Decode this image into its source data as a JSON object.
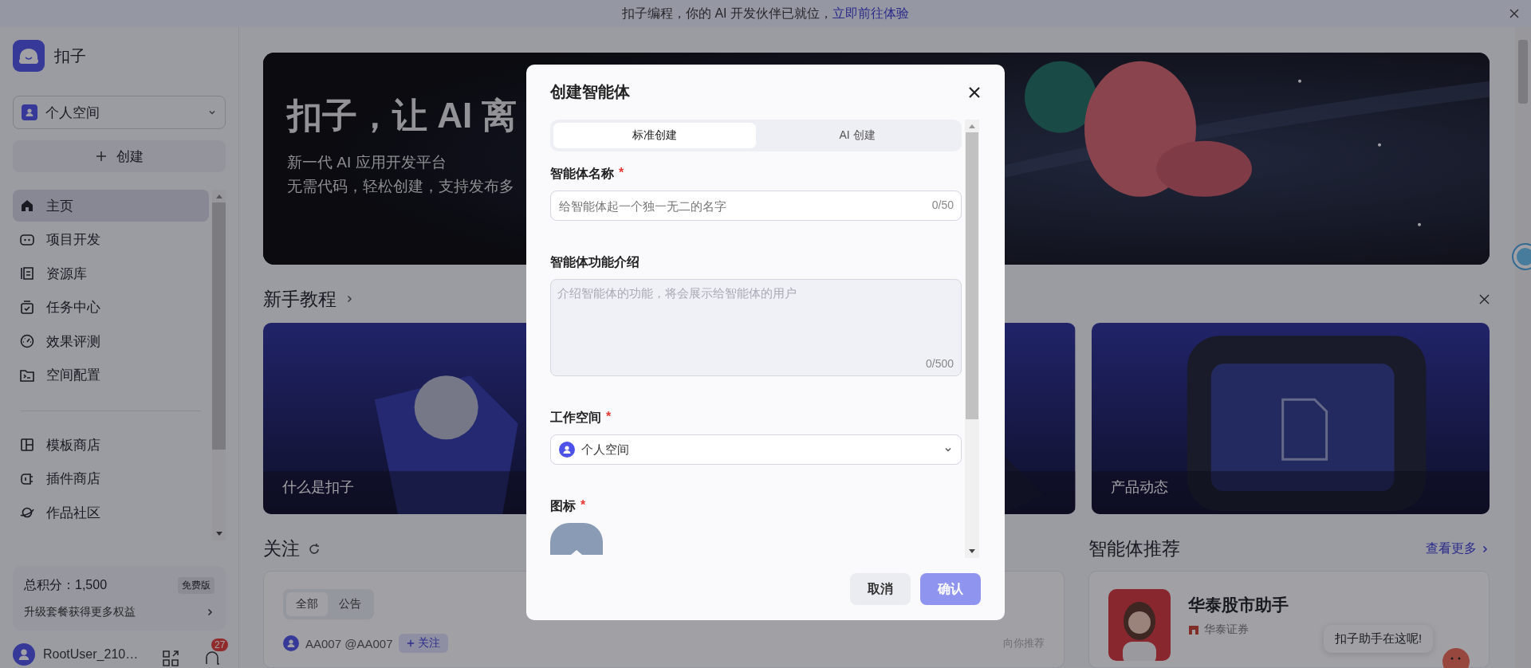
{
  "top_banner": {
    "text": "扣子编程，你的 AI 开发伙伴已就位，",
    "link": "立即前往体验"
  },
  "sidebar": {
    "brand": "扣子",
    "workspace": "个人空间",
    "create": "创建",
    "items": [
      {
        "label": "主页",
        "selected": true
      },
      {
        "label": "项目开发",
        "selected": false
      },
      {
        "label": "资源库",
        "selected": false
      },
      {
        "label": "任务中心",
        "selected": false
      },
      {
        "label": "效果评测",
        "selected": false
      },
      {
        "label": "空间配置",
        "selected": false
      },
      {
        "kind": "divider"
      },
      {
        "label": "模板商店",
        "selected": false
      },
      {
        "label": "插件商店",
        "selected": false
      },
      {
        "label": "作品社区",
        "selected": false
      }
    ],
    "points": {
      "label": "总积分：1,500",
      "badge": "免费版",
      "upgrade": "升级套餐获得更多权益"
    },
    "user": {
      "name": "RootUser_210…",
      "notifications": "27"
    }
  },
  "hero": {
    "title": "扣子，让 AI 离",
    "subtitle": [
      "新一代 AI 应用开发平台",
      "无需代码，轻松创建，支持发布多"
    ]
  },
  "tutorials": {
    "title": "新手教程",
    "cards": [
      {
        "kind": "picture",
        "title": "什么是扣子"
      },
      {
        "kind": "picture"
      },
      {
        "kind": "picture",
        "title": "产品动态"
      }
    ]
  },
  "follow": {
    "title": "关注",
    "tabs": [
      {
        "label": "全部",
        "selected": true
      },
      {
        "label": "公告",
        "selected": false
      }
    ],
    "row": {
      "name": "AA007 @AA007",
      "button": "关注",
      "note": "向你推荐"
    }
  },
  "recommend": {
    "title": "智能体推荐",
    "more": "查看更多",
    "agent": {
      "name": "华泰股市助手",
      "publisher": "华泰证券"
    }
  },
  "assistant_bubble": "扣子助手在这呢!",
  "modal": {
    "title": "创建智能体",
    "tabs": [
      {
        "label": "标准创建",
        "selected": true
      },
      {
        "label": "AI 创建",
        "selected": false
      }
    ],
    "fields": [
      {
        "kind": "input",
        "label": "智能体名称",
        "required_mark": "*",
        "placeholder": "给智能体起一个独一无二的名字",
        "counter": "0/50"
      },
      {
        "kind": "textarea",
        "label": "智能体功能介绍",
        "placeholder": "介绍智能体的功能，将会展示给智能体的用户",
        "counter": "0/500"
      },
      {
        "kind": "select",
        "label": "工作空间",
        "required_mark": "*",
        "value": "个人空间"
      },
      {
        "kind": "icon",
        "label": "图标",
        "required_mark": "*"
      }
    ],
    "buttons": [
      {
        "label": "取消",
        "disabled": false
      },
      {
        "label": "确认",
        "disabled": true
      }
    ]
  }
}
